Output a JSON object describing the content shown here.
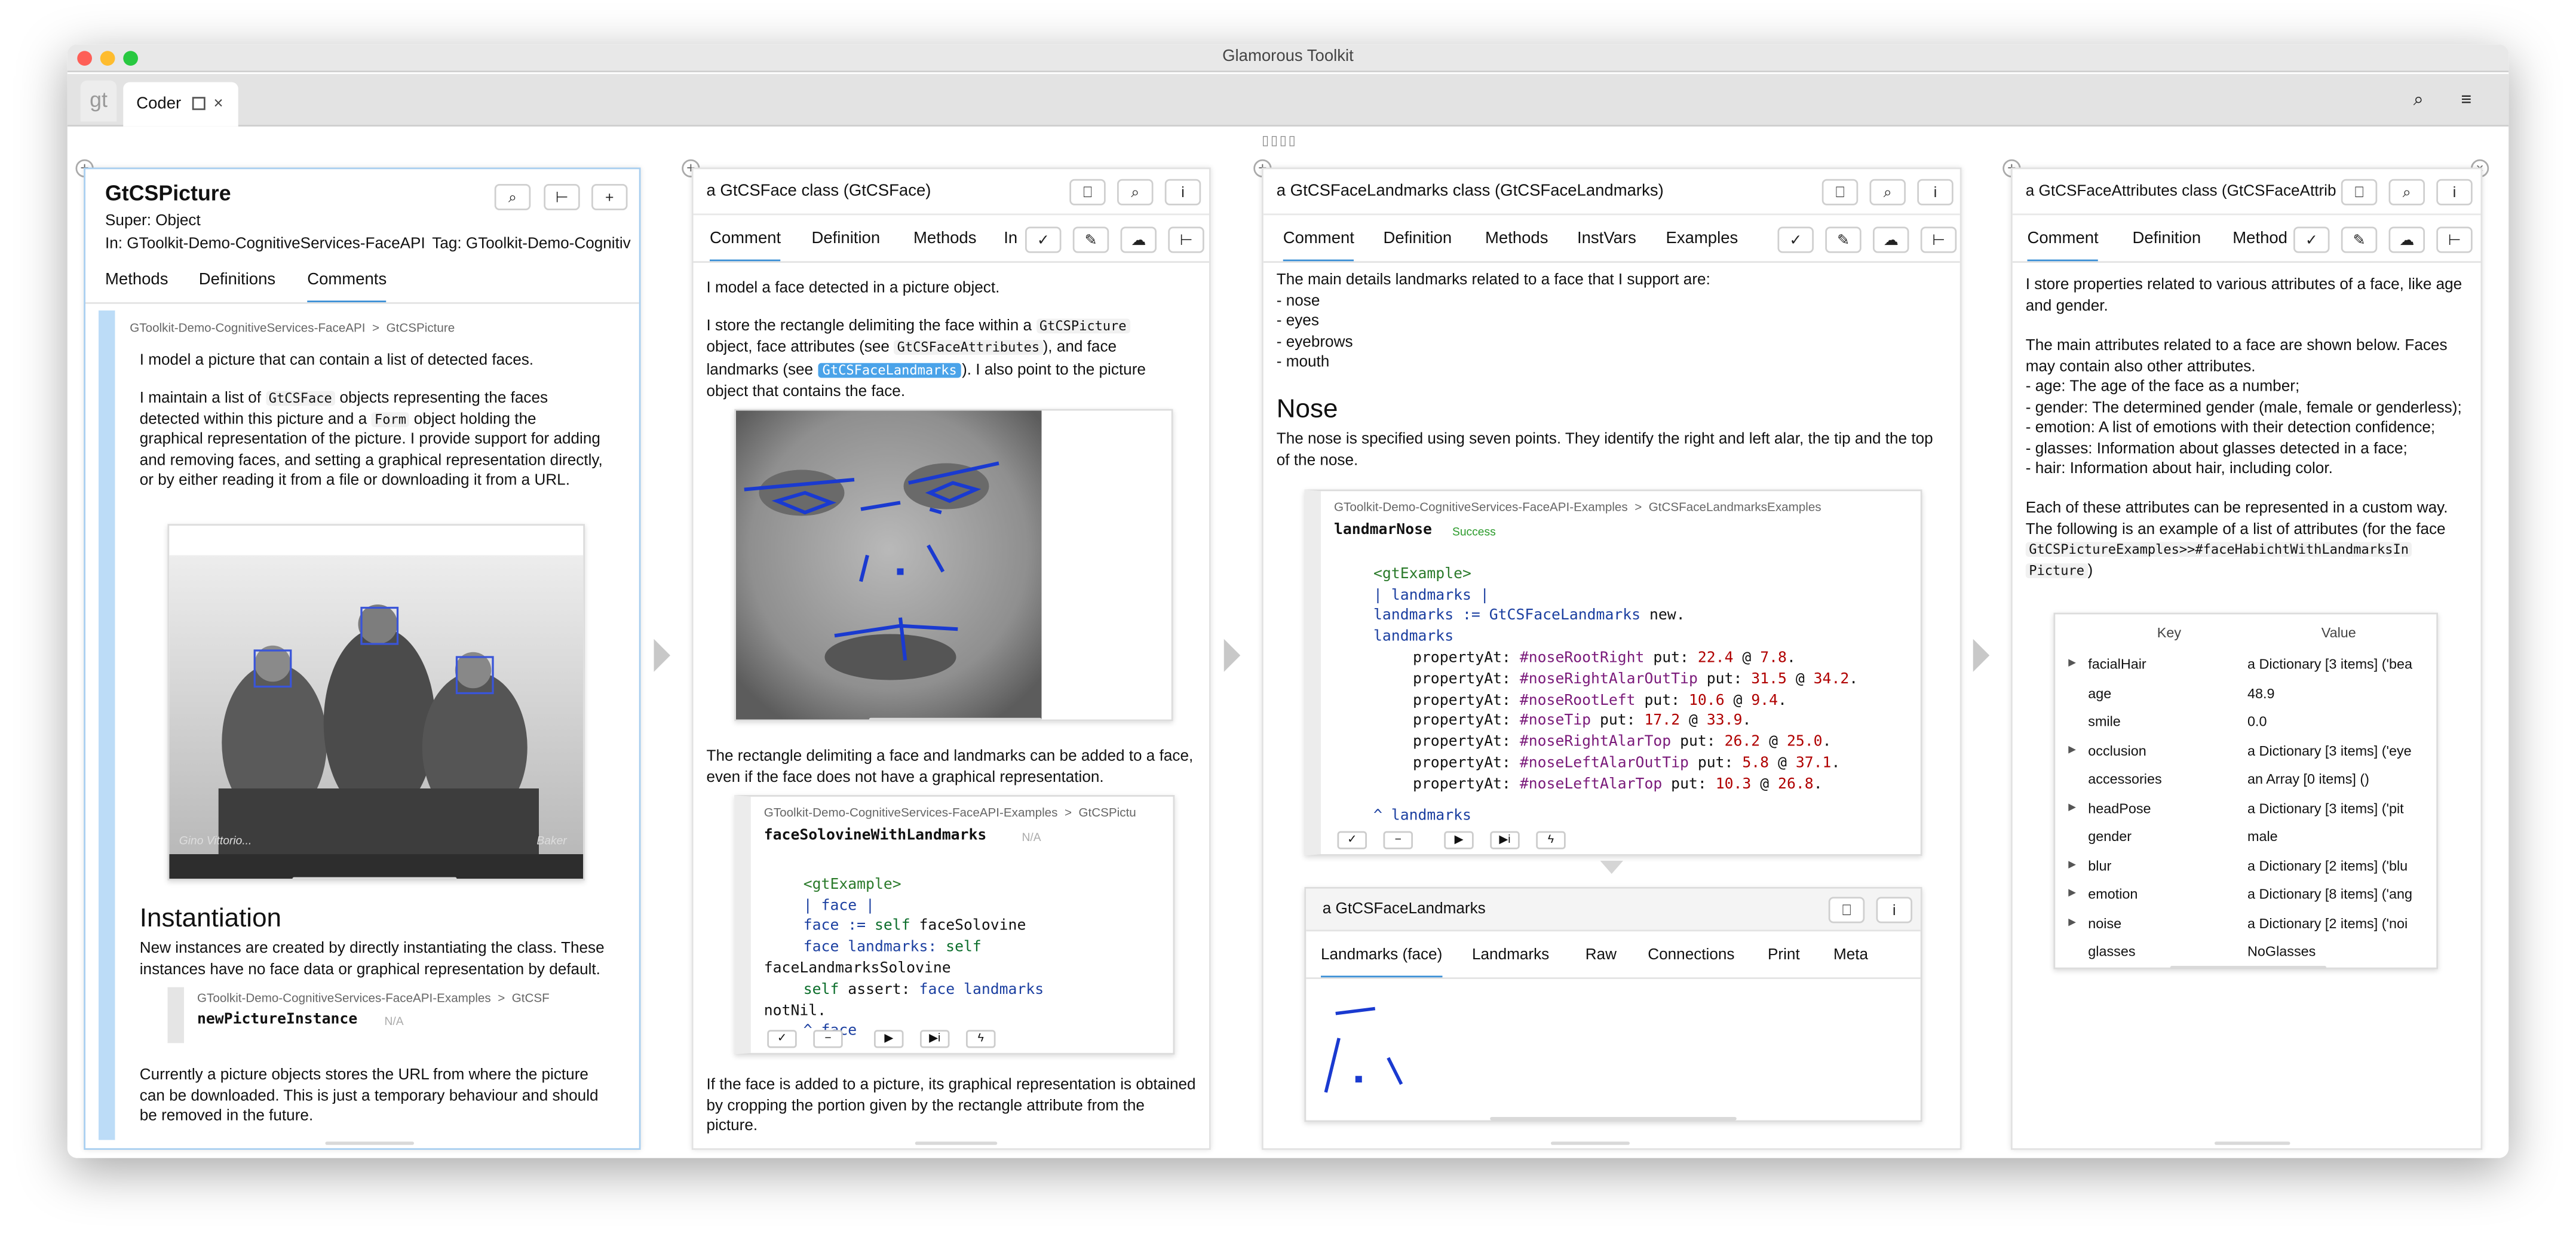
{
  "window": {
    "title": "Glamorous Toolkit",
    "logo": "gt",
    "tab_label": "Coder",
    "tab_close": "×"
  },
  "toolbar": {
    "search_icon": "⌕",
    "menu_icon": "≡",
    "strip": "▯▯▯▯"
  },
  "pane1": {
    "class_name": "GtCSPicture",
    "super": "Super: Object",
    "in": "In: GToolkit-Demo-CognitiveServices-FaceAPI",
    "tag": "Tag: GToolkit-Demo-Cognitiv",
    "tabs": [
      "Methods",
      "Definitions",
      "Comments"
    ],
    "breadcrumb": [
      "GToolkit-Demo-CognitiveServices-FaceAPI",
      ">",
      "GtCSPicture"
    ],
    "p1": "I model a picture that can contain a list of detected faces.",
    "p2a": "I maintain a list of",
    "p2code1": "GtCSFace",
    "p2b": "objects representing the faces",
    "p2c": "detected within this picture and a",
    "p2code2": "Form",
    "p2d": "object holding the",
    "p2e": "graphical representation of the picture. I provide support for adding",
    "p2f": "and removing faces, and setting a graphical representation directly,",
    "p2g": "or by either reading it from a file or downloading it from a URL.",
    "photo_signature_left": "Gino Vittorio...",
    "photo_signature_right": "Baker",
    "heading": "Instantiation",
    "p3a": "New instances are created by directly instantiating the class. These",
    "p3b": "instances have no face data or graphical representation by default.",
    "ex_crumb": [
      "GToolkit-Demo-CognitiveServices-FaceAPI-Examples",
      ">",
      "GtCSF"
    ],
    "ex_method": "newPictureInstance",
    "ex_status": "N/A",
    "p4a": "Currently a picture objects stores the URL from where the picture",
    "p4b": "can be downloaded. This is just a temporary behaviour and should",
    "p4c": "be removed in the future."
  },
  "pane2": {
    "title": "a GtCSFace class (GtCSFace)",
    "tabs": [
      "Comment",
      "Definition",
      "Methods",
      "In"
    ],
    "p1": "I model a face detected in a picture object.",
    "p2a": "I store the rectangle delimiting the face within a",
    "p2code1": "GtCSPicture",
    "p2b": "object, face attributes (see",
    "p2code2": "GtCSFaceAttributes",
    "p2c": "), and face",
    "p2d": "landmarks (see",
    "p2code3": "GtCSFaceLandmarks",
    "p2e": "). I also point to the picture",
    "p2f": "object that contains the face.",
    "p3a": "The rectangle delimiting a face and landmarks can be added to a face,",
    "p3b": "even if the face does not have a graphical representation.",
    "ex_crumb": [
      "GToolkit-Demo-CognitiveServices-FaceAPI-Examples",
      ">",
      "GtCSPictu"
    ],
    "ex_method": "faceSolovineWithLandmarks",
    "ex_status": "N/A",
    "code": {
      "l1": "<gtExample>",
      "l2": "| face |",
      "l3a": "face := ",
      "l3b": "self",
      "l3c": " faceSolovine",
      "l4a": "face landmarks: ",
      "l4b": "self",
      "l5": "faceLandmarksSolovine",
      "l6a": "self",
      "l6b": " assert: ",
      "l6c": "face landmarks",
      "l7": "notNil.",
      "l8": "^ face"
    },
    "p4a": "If the face is added to a picture, its graphical representation is obtained",
    "p4b": "by cropping the portion given by the rectangle attribute from the",
    "p4c": "picture."
  },
  "pane3": {
    "title": "a GtCSFaceLandmarks class (GtCSFaceLandmarks)",
    "tabs": [
      "Comment",
      "Definition",
      "Methods",
      "InstVars",
      "Examples"
    ],
    "intro": "The main details landmarks related to a face that I support are:",
    "list": [
      "- nose",
      "- eyes",
      "- eyebrows",
      "- mouth"
    ],
    "heading": "Nose",
    "p1a": "The nose is specified using seven points. They identify the right and left alar, the tip and the top",
    "p1b": "of the nose.",
    "ex_crumb": [
      "GToolkit-Demo-CognitiveServices-FaceAPI-Examples",
      ">",
      "GtCSFaceLandmarksExamples"
    ],
    "ex_method": "landmarNose",
    "ex_status": "Success",
    "code_pragma": "<gtExample>",
    "code_temps": "| landmarks |",
    "code_assign_a": "landmarks := ",
    "code_assign_b": "GtCSFaceLandmarks",
    "code_assign_c": " new.",
    "code_recv": "landmarks",
    "code_lines": [
      {
        "sym": "#noseRootRight",
        "a": "22.4",
        "b": "7.8"
      },
      {
        "sym": "#noseRightAlarOutTip",
        "a": "31.5",
        "b": "34.2"
      },
      {
        "sym": "#noseRootLeft",
        "a": "10.6",
        "b": "9.4"
      },
      {
        "sym": "#noseTip",
        "a": "17.2",
        "b": "33.9"
      },
      {
        "sym": "#noseRightAlarTop",
        "a": "26.2",
        "b": "25.0"
      },
      {
        "sym": "#noseLeftAlarOutTip",
        "a": "5.8",
        "b": "37.1"
      },
      {
        "sym": "#noseLeftAlarTop",
        "a": "10.3",
        "b": "26.8"
      }
    ],
    "code_prefix": "propertyAt: ",
    "code_put": " put: ",
    "code_at": " @ ",
    "code_return": "^ landmarks",
    "sub_title": "a GtCSFaceLandmarks",
    "sub_tabs": [
      "Landmarks (face)",
      "Landmarks",
      "Raw",
      "Connections",
      "Print",
      "Meta"
    ]
  },
  "pane4": {
    "title": "a GtCSFaceAttributes class (GtCSFaceAttrib",
    "tabs": [
      "Comment",
      "Definition",
      "Method"
    ],
    "p1a": "I store properties related to various attributes of a face, like age",
    "p1b": "and gender.",
    "p2": [
      "The main attributes related to a face are shown below. Faces",
      "may contain also other attributes.",
      "- age: The age of the face as a number;",
      "- gender: The determined gender (male, female or genderless);",
      "- emotion: A list of emotions with their detection confidence;",
      "- glasses: Information about glasses detected in a face;",
      "- hair: Information about hair, including color."
    ],
    "p3a": "Each of these attributes can be represented in a custom way.",
    "p3b": "The following is an example of a list of attributes (for the face",
    "p3code": "GtCSPictureExamples>>#faceHabichtWithLandmarksIn",
    "p3code2": "Picture",
    "p3end": ")",
    "table_headers": [
      "Key",
      "Value"
    ],
    "rows": [
      {
        "arrow": "▶",
        "key": "facialHair",
        "value": "a Dictionary [3 items] ('bea"
      },
      {
        "arrow": "",
        "key": "age",
        "value": "48.9"
      },
      {
        "arrow": "",
        "key": "smile",
        "value": "0.0"
      },
      {
        "arrow": "▶",
        "key": "occlusion",
        "value": "a Dictionary [3 items] ('eye"
      },
      {
        "arrow": "",
        "key": "accessories",
        "value": "an Array [0 items] ()"
      },
      {
        "arrow": "▶",
        "key": "headPose",
        "value": "a Dictionary [3 items] ('pit"
      },
      {
        "arrow": "",
        "key": "gender",
        "value": "male"
      },
      {
        "arrow": "▶",
        "key": "blur",
        "value": "a Dictionary [2 items] ('blu"
      },
      {
        "arrow": "▶",
        "key": "emotion",
        "value": "a Dictionary [8 items] ('ang"
      },
      {
        "arrow": "▶",
        "key": "noise",
        "value": "a Dictionary [2 items] ('noi"
      },
      {
        "arrow": "",
        "key": "glasses",
        "value": "NoGlasses"
      }
    ]
  },
  "colors": {
    "accent": "#3b8fd6",
    "selection": "#4aa3e9",
    "landmark": "#1a3ad0"
  }
}
